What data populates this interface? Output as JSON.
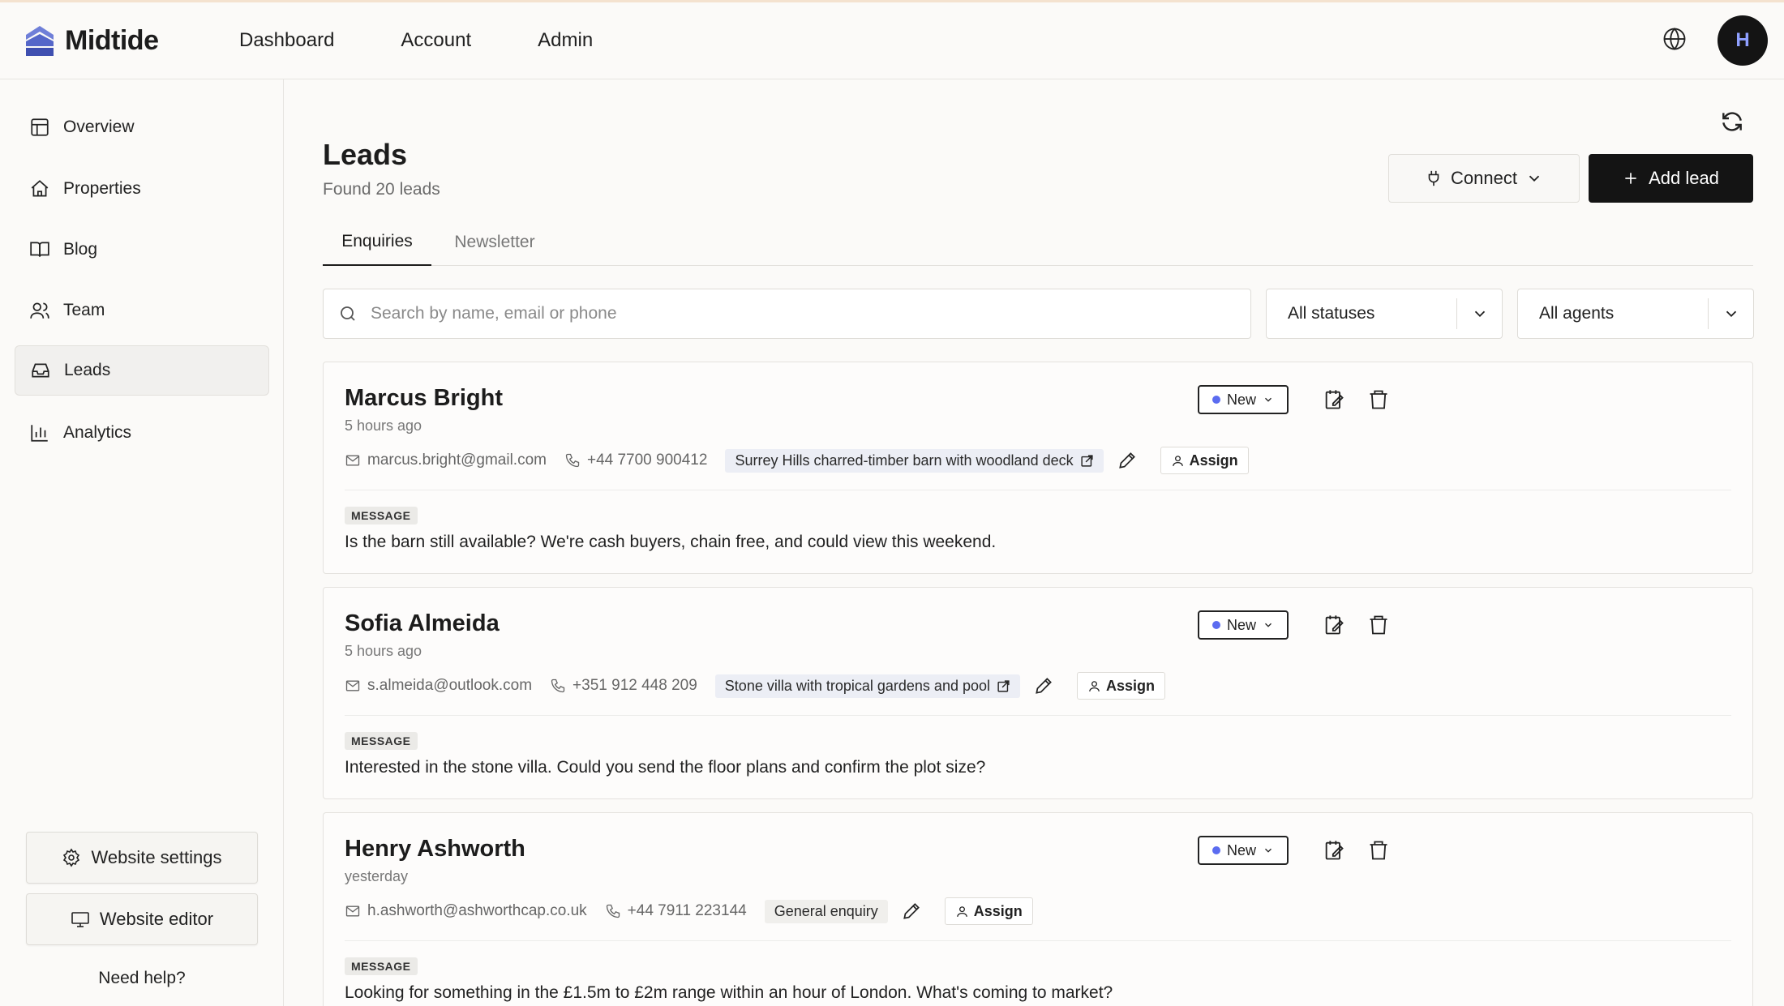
{
  "brand": {
    "name": "Midtide"
  },
  "topnav": [
    {
      "label": "Dashboard"
    },
    {
      "label": "Account"
    },
    {
      "label": "Admin"
    }
  ],
  "user": {
    "initial": "H"
  },
  "sidebar": {
    "items": [
      {
        "label": "Overview",
        "icon": "layout-icon"
      },
      {
        "label": "Properties",
        "icon": "home-icon"
      },
      {
        "label": "Blog",
        "icon": "book-icon"
      },
      {
        "label": "Team",
        "icon": "users-icon"
      },
      {
        "label": "Leads",
        "icon": "inbox-icon",
        "active": true
      },
      {
        "label": "Analytics",
        "icon": "bar-chart-icon"
      }
    ],
    "website_settings": "Website settings",
    "website_editor": "Website editor",
    "need_help": "Need help?"
  },
  "page": {
    "title": "Leads",
    "subtitle": "Found 20 leads",
    "connect_label": "Connect",
    "add_label": "Add lead"
  },
  "tabs": [
    {
      "label": "Enquiries",
      "active": true
    },
    {
      "label": "Newsletter",
      "active": false
    }
  ],
  "filters": {
    "search_placeholder": "Search by name, email or phone",
    "status": "All statuses",
    "agent": "All agents"
  },
  "common": {
    "assign_label": "Assign",
    "message_label": "MESSAGE",
    "status_label": "New"
  },
  "leads": [
    {
      "name": "Marcus Bright",
      "time": "5 hours ago",
      "email": "marcus.bright@gmail.com",
      "phone": "+44 7700 900412",
      "property": "Surrey Hills charred-timber barn with woodland deck",
      "message": "Is the barn still available? We're cash buyers, chain free, and could view this weekend."
    },
    {
      "name": "Sofia Almeida",
      "time": "5 hours ago",
      "email": "s.almeida@outlook.com",
      "phone": "+351 912 448 209",
      "property": "Stone villa with tropical gardens and pool",
      "message": "Interested in the stone villa. Could you send the floor plans and confirm the plot size?"
    },
    {
      "name": "Henry Ashworth",
      "time": "yesterday",
      "email": "h.ashworth@ashworthcap.co.uk",
      "phone": "+44 7911 223144",
      "property": "General enquiry",
      "message": "Looking for something in the £1.5m to £2m range within an hour of London. What's coming to market?"
    }
  ],
  "colors": {
    "accent": "#5b6cf0",
    "brand_blue": "#5567c9",
    "primary_button": "#141414"
  }
}
